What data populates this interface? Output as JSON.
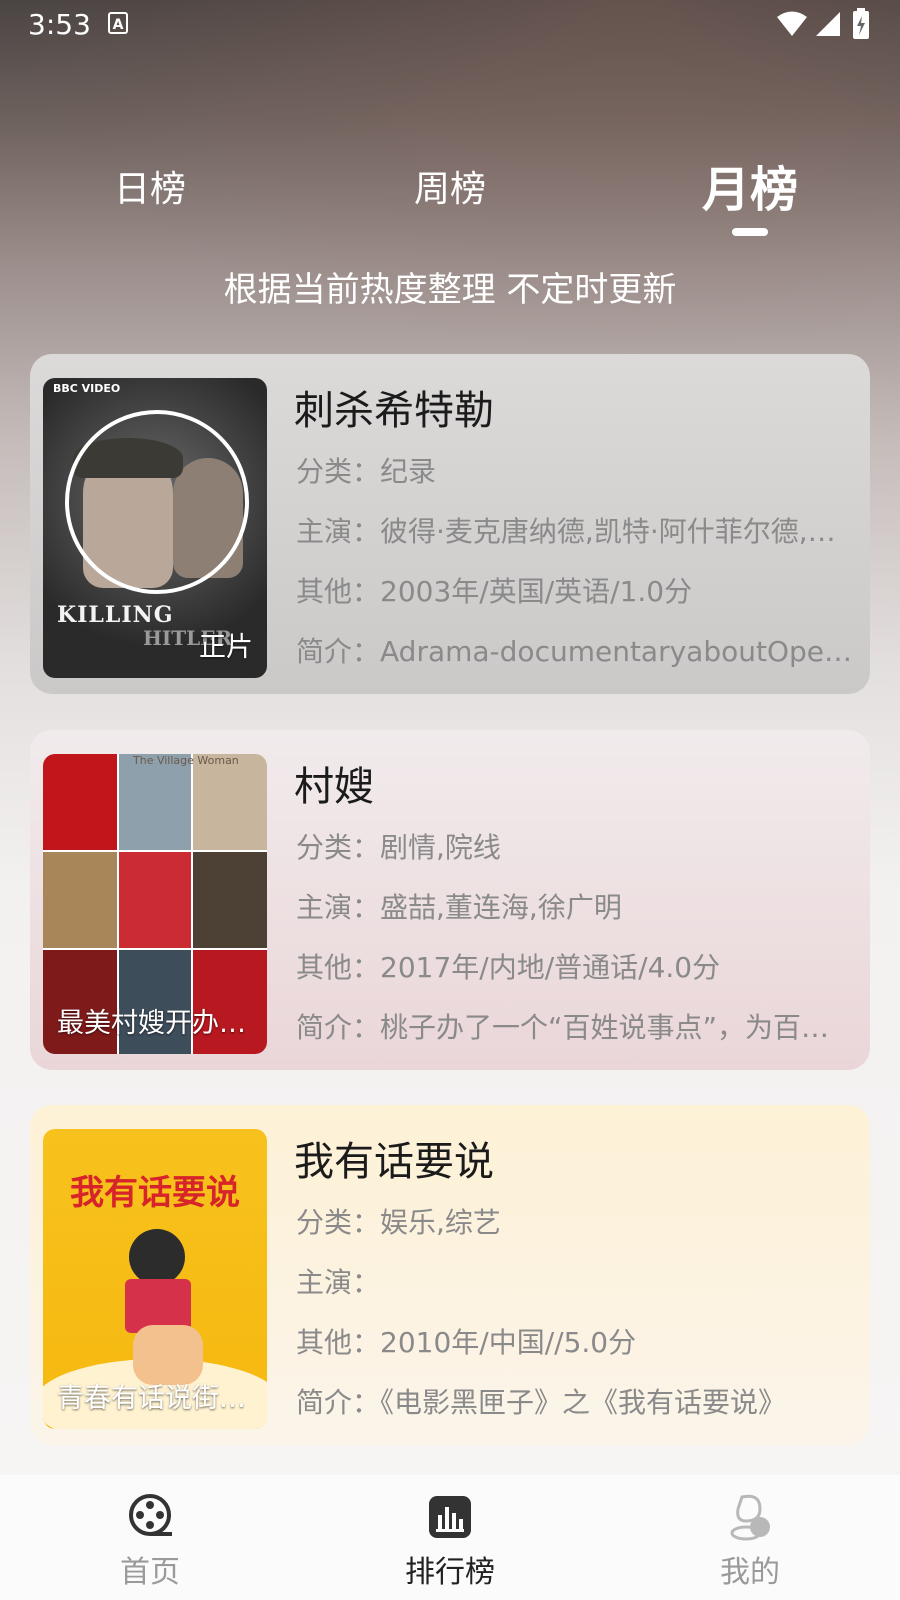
{
  "status_bar": {
    "time": "3:53",
    "notification_icon": "a-icon",
    "icons": [
      "wifi-icon",
      "signal-icon",
      "battery-charging-icon"
    ]
  },
  "tabs": [
    {
      "label": "日榜",
      "active": false
    },
    {
      "label": "周榜",
      "active": false
    },
    {
      "label": "月榜",
      "active": true
    }
  ],
  "subtitle": "根据当前热度整理 不定时更新",
  "labels": {
    "category": "分类：",
    "cast": "主演：",
    "other": "其他：",
    "intro": "简介："
  },
  "movies": [
    {
      "title": "刺杀希特勒",
      "poster_badge": "正片",
      "poster_text": {
        "top": "BBC VIDEO",
        "line1": "KILLING",
        "line2": "HITLER"
      },
      "category": "纪录",
      "cast": "彼得·麦克唐纳德,凯特·阿什菲尔德,利奥·比尔,肯尼斯·克兰汉姆",
      "other": "2003年/英国/英语/1.0分",
      "intro": "Adrama-documentaryaboutOperationFoxley"
    },
    {
      "title": "村嫂",
      "poster_badge": "最美村嫂开办百姓说事点",
      "poster_text": {
        "top": "The Village Woman"
      },
      "category": "剧情,院线",
      "cast": "盛喆,董连海,徐广明",
      "other": "2017年/内地/普通话/4.0分",
      "intro": "桃子办了一个“百姓说事点”，为百姓排忧解难"
    },
    {
      "title": "我有话要说",
      "poster_badge": "青春有话说街头采访",
      "poster_text": {
        "top": "我有话要说"
      },
      "category": "娱乐,综艺",
      "cast": "",
      "other": "2010年/中国//5.0分",
      "intro": "《电影黑匣子》之《我有话要说》"
    }
  ],
  "nav": [
    {
      "label": "首页",
      "icon": "film-reel-icon",
      "active": false
    },
    {
      "label": "排行榜",
      "icon": "chart-bars-icon",
      "active": true
    },
    {
      "label": "我的",
      "icon": "profile-icon",
      "active": false
    }
  ],
  "colors": {
    "active_nav": "#222222",
    "inactive_nav": "#9a9a9a",
    "meta_text": "#8a8a8a",
    "title_text": "#1b1b1b"
  }
}
